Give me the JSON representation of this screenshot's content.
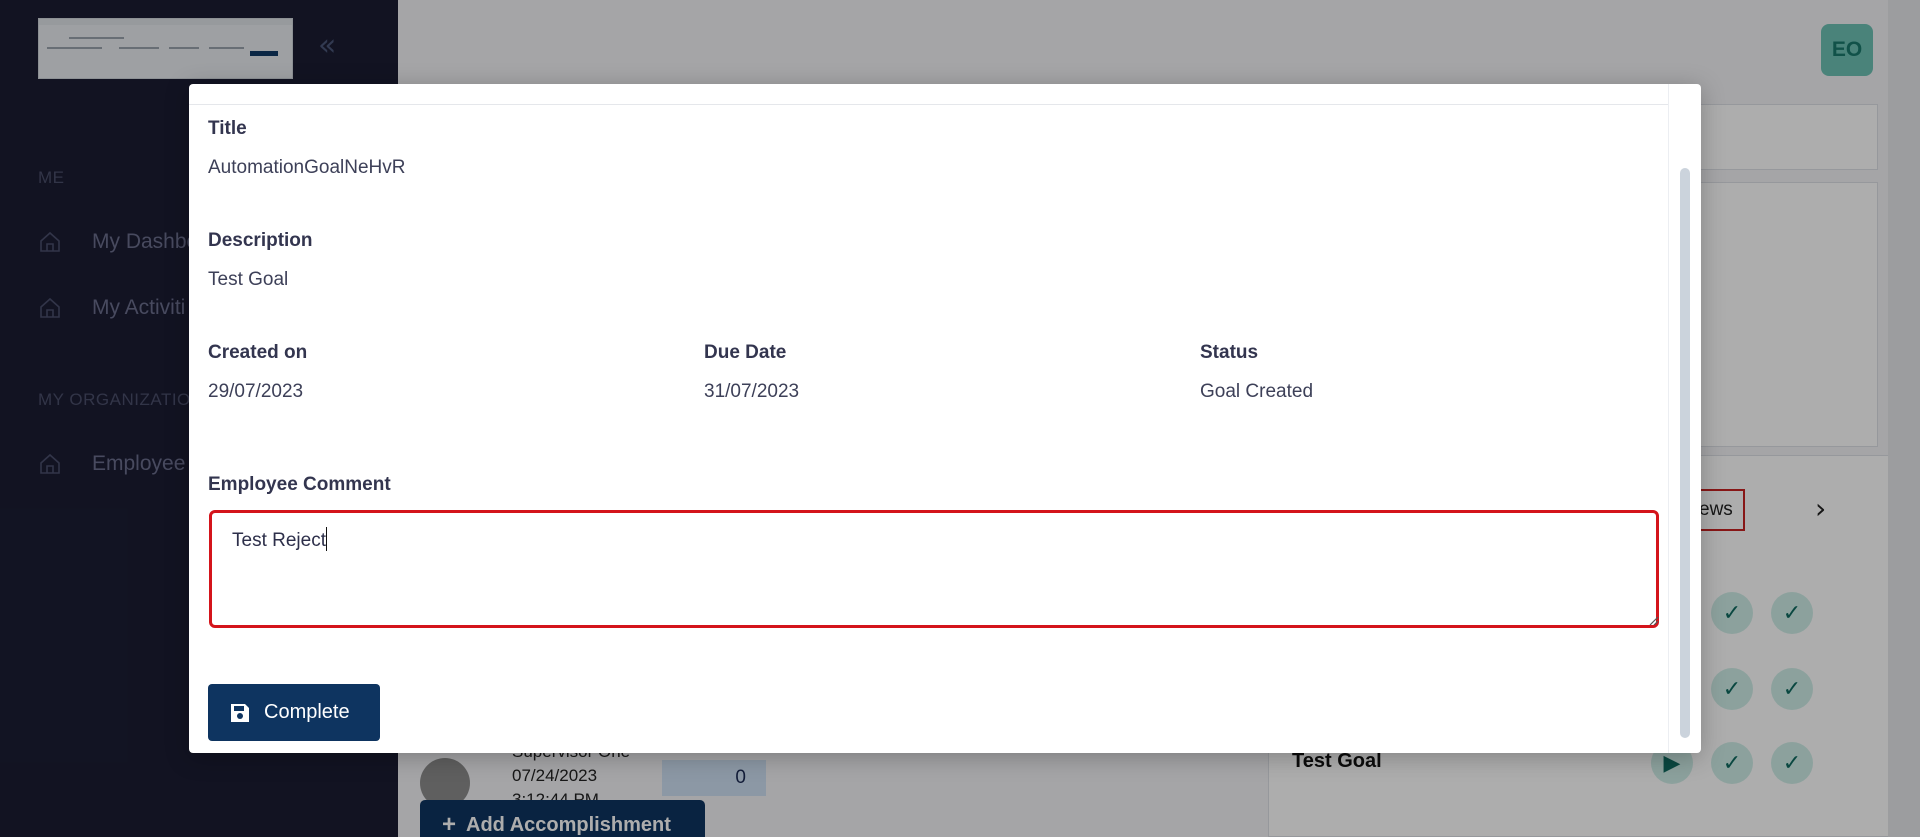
{
  "sidebar": {
    "sections": [
      {
        "label": "ME"
      },
      {
        "label": "MY ORGANIZATIO"
      }
    ],
    "items": [
      {
        "label": "My Dashbo",
        "icon": "home-icon"
      },
      {
        "label": "My Activiti",
        "icon": "home-icon"
      },
      {
        "label": "Employee",
        "icon": "home-icon"
      }
    ],
    "collapse_icon": "double-chevron-left-icon"
  },
  "header": {
    "avatar_initials": "EO"
  },
  "background": {
    "reviews_tab_label": "ews",
    "goal_title": "Test Goal",
    "person_name": "Supervisor One",
    "person_date": "07/24/2023",
    "person_time": "3:12:44 PM",
    "comment_count": "0",
    "add_button_label": "Add Accomplishment"
  },
  "modal": {
    "title_label": "Title",
    "title_value": "AutomationGoalNeHvR",
    "description_label": "Description",
    "description_value": "Test Goal",
    "created_label": "Created on",
    "created_value": "29/07/2023",
    "due_label": "Due Date",
    "due_value": "31/07/2023",
    "status_label": "Status",
    "status_value": "Goal Created",
    "comment_label": "Employee Comment",
    "comment_value": "Test Reject",
    "complete_button_label": "Complete",
    "complete_button_icon": "save-icon"
  },
  "colors": {
    "primary": "#0e3460",
    "error_border": "#d4141b",
    "sidebar_bg": "#1b1d33",
    "avatar_bg": "#6ec1b4"
  }
}
